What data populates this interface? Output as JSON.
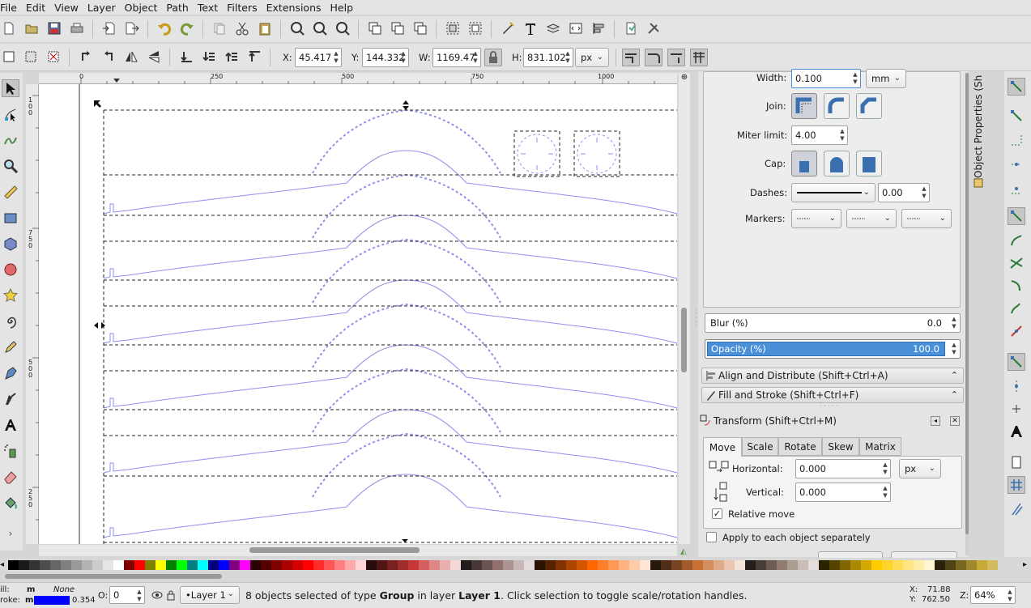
{
  "menu": [
    "File",
    "Edit",
    "View",
    "Layer",
    "Object",
    "Path",
    "Text",
    "Filters",
    "Extensions",
    "Help"
  ],
  "command_bar": {
    "icons": [
      "new-document-icon",
      "open-icon",
      "save-icon",
      "print-icon",
      "import-icon",
      "export-icon",
      "undo-icon",
      "redo-icon",
      "duplicate-icon",
      "cut-icon",
      "paste-icon",
      "zoom-selection-icon",
      "zoom-drawing-icon",
      "zoom-page-icon",
      "group-duplicate-icon",
      "clone-icon",
      "unlink-clone-icon",
      "group-icon",
      "ungroup-icon",
      "fill-stroke-icon",
      "text-font-icon",
      "layers-icon",
      "xml-editor-icon",
      "align-distribute-icon",
      "document-properties-icon",
      "preferences-icon"
    ]
  },
  "controls": {
    "x_label": "X:",
    "x_value": "45.417",
    "y_label": "Y:",
    "y_value": "144.332",
    "w_label": "W:",
    "w_value": "1169.47",
    "h_label": "H:",
    "h_value": "831.102",
    "unit": "px"
  },
  "rulers": {
    "h_ticks": [
      "0",
      "250",
      "500",
      "750",
      "1000"
    ],
    "v_ticks": [
      "1\n0\n0",
      "7\n5\n0",
      "5\n0\n0",
      "2\n5\n0"
    ]
  },
  "panel": {
    "title_vertical": "Object Properties (Sh",
    "stroke_style": {
      "width_label": "Width:",
      "width_value": "0.100",
      "width_unit": "mm",
      "join_label": "Join:",
      "miter_label": "Miter limit:",
      "miter_value": "4.00",
      "cap_label": "Cap:",
      "dashes_label": "Dashes:",
      "dashes_value": "0.00",
      "markers_label": "Markers:"
    },
    "blur_label": "Blur (%)",
    "blur_value": "0.0",
    "opacity_label": "Opacity (%)",
    "opacity_value": "100.0",
    "docks": [
      "Align and Distribute (Shift+Ctrl+A)",
      "Fill and Stroke (Shift+Ctrl+F)"
    ],
    "transform": {
      "title": "Transform (Shift+Ctrl+M)",
      "tabs": [
        "Move",
        "Scale",
        "Rotate",
        "Skew",
        "Matrix"
      ],
      "active_tab": "Move",
      "horizontal_label": "Horizontal:",
      "horizontal_value": "0.000",
      "unit": "px",
      "vertical_label": "Vertical:",
      "vertical_value": "0.000",
      "relative_move_label": "Relative move",
      "relative_move_checked": true,
      "apply_each_label": "Apply to each object separately",
      "apply_each_checked": false
    }
  },
  "palette_colors": [
    "#000000",
    "#1a1a1a",
    "#333333",
    "#4d4d4d",
    "#666666",
    "#808080",
    "#999999",
    "#b3b3b3",
    "#cccccc",
    "#e6e6e6",
    "#ffffff",
    "#800000",
    "#ff0000",
    "#808000",
    "#ffff00",
    "#008000",
    "#00ff00",
    "#008080",
    "#00ffff",
    "#000080",
    "#0000ff",
    "#800080",
    "#ff00ff",
    "#2b0000",
    "#550000",
    "#800000",
    "#aa0000",
    "#d40000",
    "#ff0000",
    "#ff2a2a",
    "#ff5555",
    "#ff8080",
    "#ffaaaa",
    "#ffd5d5",
    "#280b0b",
    "#501616",
    "#782121",
    "#a02c2c",
    "#c83737",
    "#d35f5f",
    "#de8787",
    "#e9afaf",
    "#f4d7d7",
    "#241c1c",
    "#483737",
    "#6c5353",
    "#916f6f",
    "#ac9393",
    "#c8b7b7",
    "#e3dbdb",
    "#2b1100",
    "#552200",
    "#803300",
    "#aa4400",
    "#d45500",
    "#ff6600",
    "#ff7f2a",
    "#ff9955",
    "#ffb380",
    "#ffccaa",
    "#ffe6d5",
    "#28170b",
    "#502d16",
    "#784421",
    "#a05a2c",
    "#c87137",
    "#d38d5f",
    "#deaa87",
    "#e9c6af",
    "#f4e3d7",
    "#241f1c",
    "#483e37",
    "#6c5d53",
    "#917c6f",
    "#ac9d93",
    "#c8beb7",
    "#e3dedb",
    "#2b2200",
    "#554400",
    "#806600",
    "#aa8800",
    "#d4aa00",
    "#ffcc00",
    "#ffd42a",
    "#ffdd55",
    "#ffe680",
    "#ffeeaa",
    "#fff6d5",
    "#28220b",
    "#504416",
    "#786721",
    "#a0892c",
    "#c8ab37",
    "#d3bc5f"
  ],
  "status": {
    "fill_label": "ill:",
    "fill_value": "m",
    "fill_state": "None",
    "stroke_label": "roke:",
    "stroke_value": "m",
    "stroke_width": "0.354",
    "opacity_label": "O:",
    "opacity_value": "0",
    "layer": "•Layer 1",
    "message_pre": "8 objects selected of type ",
    "message_type": "Group",
    "message_mid": " in layer ",
    "message_layer": "Layer 1",
    "message_post": ". Click selection to toggle scale/rotation handles.",
    "cursor_x_label": "X:",
    "cursor_x": "71.88",
    "cursor_y_label": "Y:",
    "cursor_y": "762.50",
    "zoom_label": "Z:",
    "zoom_value": "64%"
  },
  "colors": {
    "accent": "#4a90d9",
    "drawing_stroke": "#8f8fef",
    "selection_dash": "#222222"
  }
}
